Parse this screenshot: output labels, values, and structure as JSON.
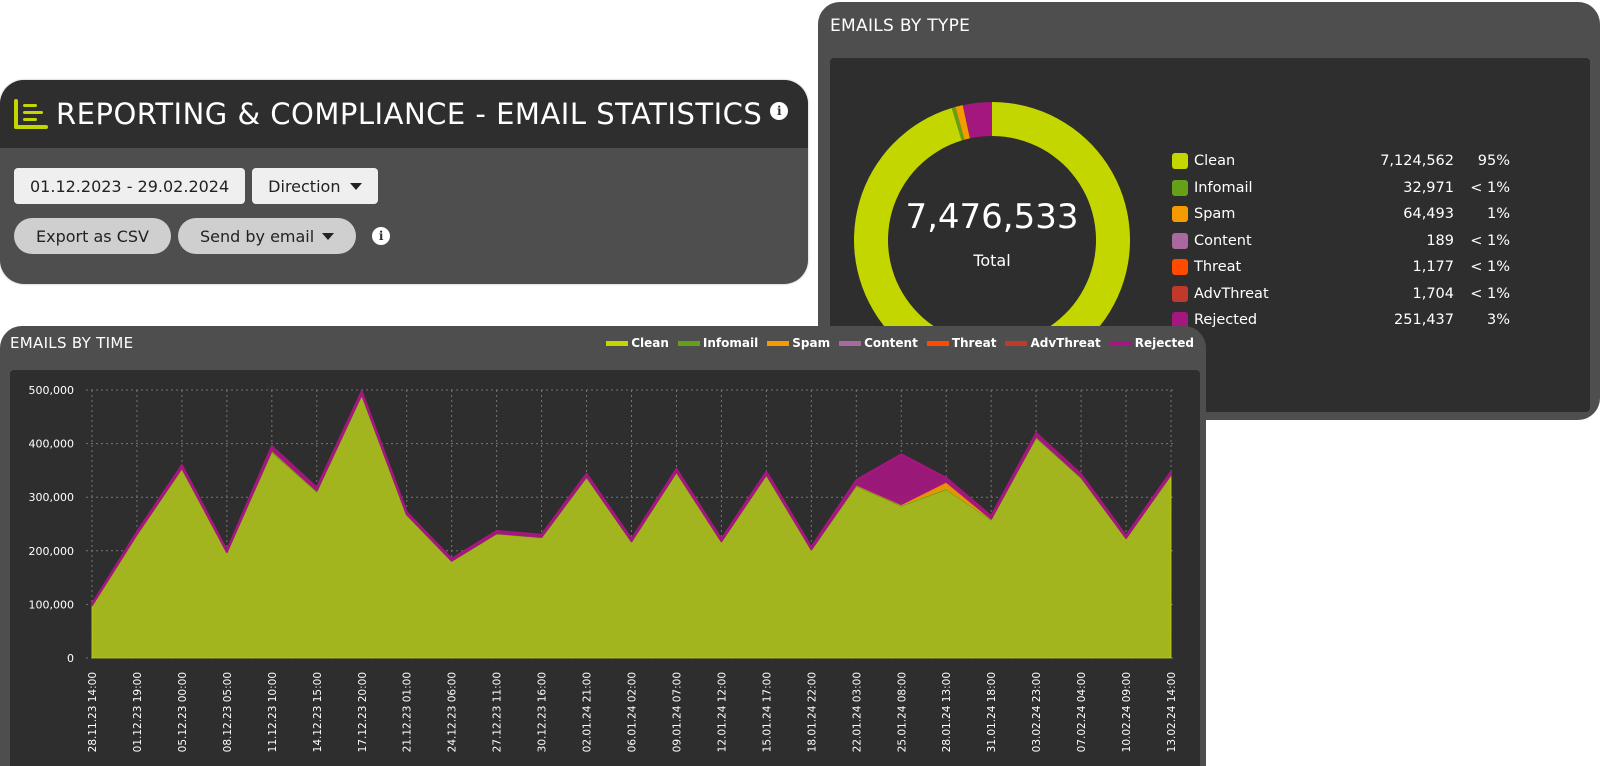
{
  "header": {
    "title": "REPORTING & COMPLIANCE - EMAIL STATISTICS",
    "logo_icon": "reporting-logo-icon",
    "info_icon": "info-icon"
  },
  "controls": {
    "date_range": "01.12.2023 - 29.02.2024",
    "direction_label": "Direction",
    "export_label": "Export as CSV",
    "send_label": "Send by email",
    "info_icon": "info-icon"
  },
  "colors": {
    "accent": "#c4d600",
    "panel_bg": "#4e4e4e",
    "inner_bg": "#2e2e2e"
  },
  "type_panel": {
    "title": "EMAILS BY TYPE",
    "total": "7,476,533",
    "total_label": "Total"
  },
  "time_panel": {
    "title": "EMAILS BY TIME"
  },
  "chart_data": [
    {
      "type": "pie",
      "variant": "donut",
      "title": "EMAILS BY TYPE",
      "center_value": "7,476,533",
      "center_label": "Total",
      "legend_position": "right",
      "slices": [
        {
          "name": "Clean",
          "value": 7124562,
          "count_label": "7,124,562",
          "pct_label": "95%",
          "color": "#c4d600"
        },
        {
          "name": "Infomail",
          "value": 32971,
          "count_label": "32,971",
          "pct_label": "< 1%",
          "color": "#66a019"
        },
        {
          "name": "Spam",
          "value": 64493,
          "count_label": "64,493",
          "pct_label": "1%",
          "color": "#f59b00"
        },
        {
          "name": "Content",
          "value": 189,
          "count_label": "189",
          "pct_label": "< 1%",
          "color": "#a8699e"
        },
        {
          "name": "Threat",
          "value": 1177,
          "count_label": "1,177",
          "pct_label": "< 1%",
          "color": "#ff4a00"
        },
        {
          "name": "AdvThreat",
          "value": 1704,
          "count_label": "1,704",
          "pct_label": "< 1%",
          "color": "#c0392b"
        },
        {
          "name": "Rejected",
          "value": 251437,
          "count_label": "251,437",
          "pct_label": "3%",
          "color": "#a4177e"
        }
      ]
    },
    {
      "type": "area",
      "stacked": true,
      "title": "EMAILS BY TIME",
      "legend_position": "top-right",
      "grid": true,
      "ylim": [
        0,
        500000
      ],
      "yticks": [
        "0",
        "100,000",
        "200,000",
        "300,000",
        "400,000",
        "500,000"
      ],
      "ytick_values": [
        0,
        100000,
        200000,
        300000,
        400000,
        500000
      ],
      "x": [
        "28.11.23 14:00",
        "01.12.23 19:00",
        "05.12.23 00:00",
        "08.12.23 05:00",
        "11.12.23 10:00",
        "14.12.23 15:00",
        "17.12.23 20:00",
        "21.12.23 01:00",
        "24.12.23 06:00",
        "27.12.23 11:00",
        "30.12.23 16:00",
        "02.01.24 21:00",
        "06.01.24 02:00",
        "09.01.24 07:00",
        "12.01.24 12:00",
        "15.01.24 17:00",
        "18.01.24 22:00",
        "22.01.24 03:00",
        "25.01.24 08:00",
        "28.01.24 13:00",
        "31.01.24 18:00",
        "03.02.24 23:00",
        "07.02.24 04:00",
        "10.02.24 09:00",
        "13.02.24 14:00"
      ],
      "series": [
        {
          "name": "Clean",
          "color": "#c4d600",
          "values": [
            97000,
            229000,
            352000,
            196000,
            383000,
            309000,
            489000,
            266000,
            180000,
            231000,
            224000,
            336000,
            216000,
            345000,
            216000,
            340000,
            201000,
            320000,
            283000,
            314000,
            257000,
            410000,
            335000,
            222000,
            340000
          ]
        },
        {
          "name": "Infomail",
          "color": "#66a019",
          "values": [
            1000,
            1500,
            2000,
            1200,
            2500,
            2000,
            2500,
            1500,
            1000,
            1300,
            1200,
            1800,
            1200,
            1800,
            1200,
            1800,
            1200,
            1800,
            2000,
            2000,
            1500,
            2200,
            1800,
            1300,
            1800
          ]
        },
        {
          "name": "Spam",
          "color": "#f59b00",
          "values": [
            500,
            800,
            1000,
            600,
            2500,
            1500,
            1000,
            800,
            600,
            700,
            700,
            1000,
            700,
            1000,
            700,
            1000,
            700,
            2000,
            2000,
            13000,
            1500,
            1500,
            1200,
            800,
            1000
          ]
        },
        {
          "name": "Content",
          "color": "#a8699e",
          "values": [
            0,
            0,
            0,
            0,
            0,
            0,
            0,
            0,
            0,
            0,
            0,
            0,
            0,
            0,
            0,
            0,
            0,
            0,
            0,
            0,
            0,
            0,
            0,
            0,
            0
          ]
        },
        {
          "name": "Threat",
          "color": "#ff4a00",
          "values": [
            0,
            0,
            0,
            0,
            0,
            0,
            0,
            0,
            0,
            0,
            0,
            0,
            0,
            0,
            0,
            0,
            0,
            0,
            0,
            0,
            0,
            0,
            0,
            0,
            0
          ]
        },
        {
          "name": "AdvThreat",
          "color": "#c0392b",
          "values": [
            0,
            0,
            0,
            0,
            0,
            0,
            0,
            0,
            0,
            0,
            0,
            0,
            0,
            0,
            0,
            0,
            0,
            0,
            0,
            0,
            0,
            0,
            0,
            0,
            0
          ]
        },
        {
          "name": "Rejected",
          "color": "#a4177e",
          "values": [
            2500,
            4000,
            5000,
            3000,
            7000,
            5500,
            5000,
            4000,
            3500,
            4000,
            4000,
            5000,
            4000,
            5000,
            4000,
            5000,
            4000,
            8000,
            93000,
            7000,
            5000,
            6000,
            5000,
            4000,
            4500
          ]
        }
      ]
    }
  ]
}
